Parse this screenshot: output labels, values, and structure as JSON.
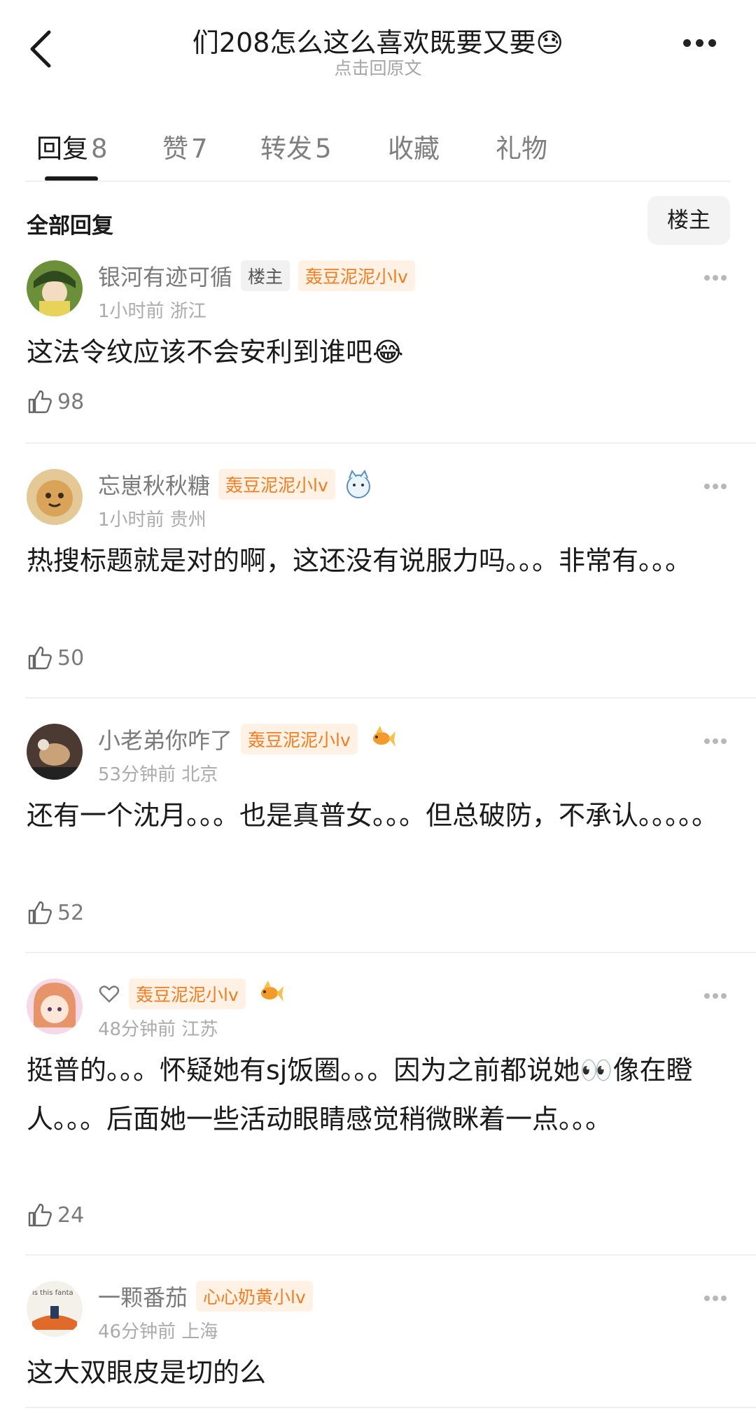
{
  "header": {
    "title": "们208怎么这么喜欢既要又要😓",
    "subtitle": "点击回原文"
  },
  "tabs": [
    {
      "label": "回复",
      "count": "8"
    },
    {
      "label": "赞",
      "count": "7"
    },
    {
      "label": "转发",
      "count": "5"
    },
    {
      "label": "收藏",
      "count": ""
    },
    {
      "label": "礼物",
      "count": ""
    }
  ],
  "section": {
    "title": "全部回复",
    "filter_label": "楼主"
  },
  "comments": [
    {
      "username": "银河有迹可循",
      "owner_tag": "楼主",
      "fan_tag": "轰豆泥泥小lv",
      "meta": "1小时前 浙江",
      "text": "这法令纹应该不会安利到谁吧😂",
      "likes": "98"
    },
    {
      "username": "忘崽秋秋糖",
      "fan_tag": "轰豆泥泥小lv",
      "meta": "1小时前 贵州",
      "text": "热搜标题就是对的啊，这还没有说服力吗。。。非常有。。。",
      "likes": "50"
    },
    {
      "username": "小老弟你咋了",
      "fan_tag": "轰豆泥泥小lv",
      "meta": "53分钟前 北京",
      "text": "还有一个沈月。。。也是真普女。。。但总破防，不承认。。。。。",
      "likes": "52"
    },
    {
      "username": "",
      "fan_tag": "轰豆泥泥小lv",
      "meta": "48分钟前 江苏",
      "text": "挺普的。。。怀疑她有sj饭圈。。。因为之前都说她👀像在瞪人。。。后面她一些活动眼睛感觉稍微眯着一点。。。",
      "likes": "24"
    },
    {
      "username": "一颗番茄",
      "fan_tag": "心心奶黄小lv",
      "meta": "46分钟前 上海",
      "text": "这大双眼皮是切的么",
      "likes": ""
    }
  ],
  "colors": {
    "fan_tag_text": "#f07d22",
    "fan_tag_bg": "#fff1e3"
  }
}
